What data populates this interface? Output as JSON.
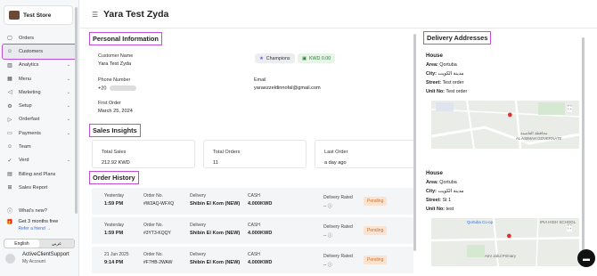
{
  "store": {
    "name": "Test Store"
  },
  "sidebar": {
    "items": [
      {
        "label": "Orders",
        "icon": "orders-icon",
        "glyph": "▢",
        "chevron": false
      },
      {
        "label": "Customers",
        "icon": "customers-icon",
        "glyph": "☺",
        "chevron": false,
        "active": true
      },
      {
        "label": "Analytics",
        "icon": "analytics-icon",
        "glyph": "▥",
        "chevron": true
      },
      {
        "label": "Menu",
        "icon": "menu-grid-icon",
        "glyph": "▦",
        "chevron": true
      },
      {
        "label": "Marketing",
        "icon": "megaphone-icon",
        "glyph": "◁",
        "chevron": true
      },
      {
        "label": "Setup",
        "icon": "setup-icon",
        "glyph": "⚙",
        "chevron": true
      },
      {
        "label": "Orderfast",
        "icon": "orderfast-icon",
        "glyph": "▷",
        "chevron": true
      },
      {
        "label": "Payments",
        "icon": "payments-icon",
        "glyph": "▭",
        "chevron": true
      },
      {
        "label": "Team",
        "icon": "team-icon",
        "glyph": "☺",
        "chevron": false
      },
      {
        "label": "Verd",
        "icon": "verd-icon",
        "glyph": "✓",
        "chevron": true
      },
      {
        "label": "Billing and Plans",
        "icon": "billing-icon",
        "glyph": "▤",
        "chevron": false
      },
      {
        "label": "Sales Report",
        "icon": "report-icon",
        "glyph": "⊞",
        "chevron": false
      }
    ],
    "whats_new": "What's new?",
    "promo_title": "Get 3 months free",
    "promo_link": "Refer a friend →",
    "lang_en": "English",
    "lang_ar": "عربي",
    "user_name": "ActiveClientSupport",
    "user_sub": "My Account"
  },
  "header": {
    "title": "Yara Test Zyda"
  },
  "personal": {
    "section_title": "Personal Information",
    "name_label": "Customer Name",
    "name_value": "Yara Test Zyda",
    "tag_champions": "Champions",
    "tag_kwd": "KWD 0.00",
    "phone_label": "Phone Number",
    "phone_value": "+20",
    "email_label": "Email",
    "email_value": "yaraezzeldinnofal@gmail.com",
    "first_order_label": "First Order",
    "first_order_value": "March 25, 2024"
  },
  "insights": {
    "section_title": "Sales Insights",
    "cards": [
      {
        "label": "Total Sales",
        "value": "212.92 KWD"
      },
      {
        "label": "Total Orders",
        "value": "11"
      },
      {
        "label": "Last Order",
        "value": "a day ago"
      }
    ]
  },
  "history": {
    "section_title": "Order History",
    "orders": [
      {
        "date": "Yesterday",
        "time": "1:59 PM",
        "order_label": "Order No.",
        "order_no": "#W2AQ-WFXQ",
        "delivery_label": "Delivery",
        "branch": "Shibin El Kom (NEW)",
        "pay_label": "CASH",
        "amount": "4.000KWD",
        "rated_label": "Delivery Rated",
        "rated": "--",
        "status": "Pending"
      },
      {
        "date": "Yesterday",
        "time": "1:59 PM",
        "order_label": "Order No.",
        "order_no": "#3YT3-KQQY",
        "delivery_label": "Delivery",
        "branch": "Shibin El Kom (NEW)",
        "pay_label": "CASH",
        "amount": "4.000KWD",
        "rated_label": "Delivery Rated",
        "rated": "--",
        "status": "Pending"
      },
      {
        "date": "21 Jun 2025",
        "time": "9:14 PM",
        "order_label": "Order No.",
        "order_no": "#F7HB-2WAW",
        "delivery_label": "Delivery",
        "branch": "Shibin El Kom (NEW)",
        "pay_label": "CASH",
        "amount": "4.000KWD",
        "rated_label": "Delivery Rated",
        "rated": "--",
        "status": "Pending"
      }
    ]
  },
  "delivery": {
    "section_title": "Delivery Addresses",
    "addresses": [
      {
        "title": "House",
        "area_label": "Area:",
        "area": "Qortuba",
        "city_label": "City:",
        "city": "مدينة الكويت",
        "street_label": "Street:",
        "street": "Test order",
        "unit_label": "Unit No:",
        "unit": "Test order",
        "map_label": "AL ASIMAH GOVERNATE",
        "map_label_ar": "محافظة العاصمة"
      },
      {
        "title": "House",
        "area_label": "Area:",
        "area": "Qortuba",
        "city_label": "City:",
        "city": "مدينة الكويت",
        "street_label": "Street:",
        "street": "St 1",
        "unit_label": "Unit No:",
        "unit": "test",
        "map_label": "Qortuba Co-op",
        "map_label2": "Amr Jaful Primary",
        "map_label3": "IPIA HIGH SCHOOL"
      }
    ]
  },
  "colors": {
    "accent_outline": "#c04ed6",
    "pending_bg": "#fbe3d2",
    "pending_text": "#c7712c",
    "marker": "#e0312e"
  }
}
